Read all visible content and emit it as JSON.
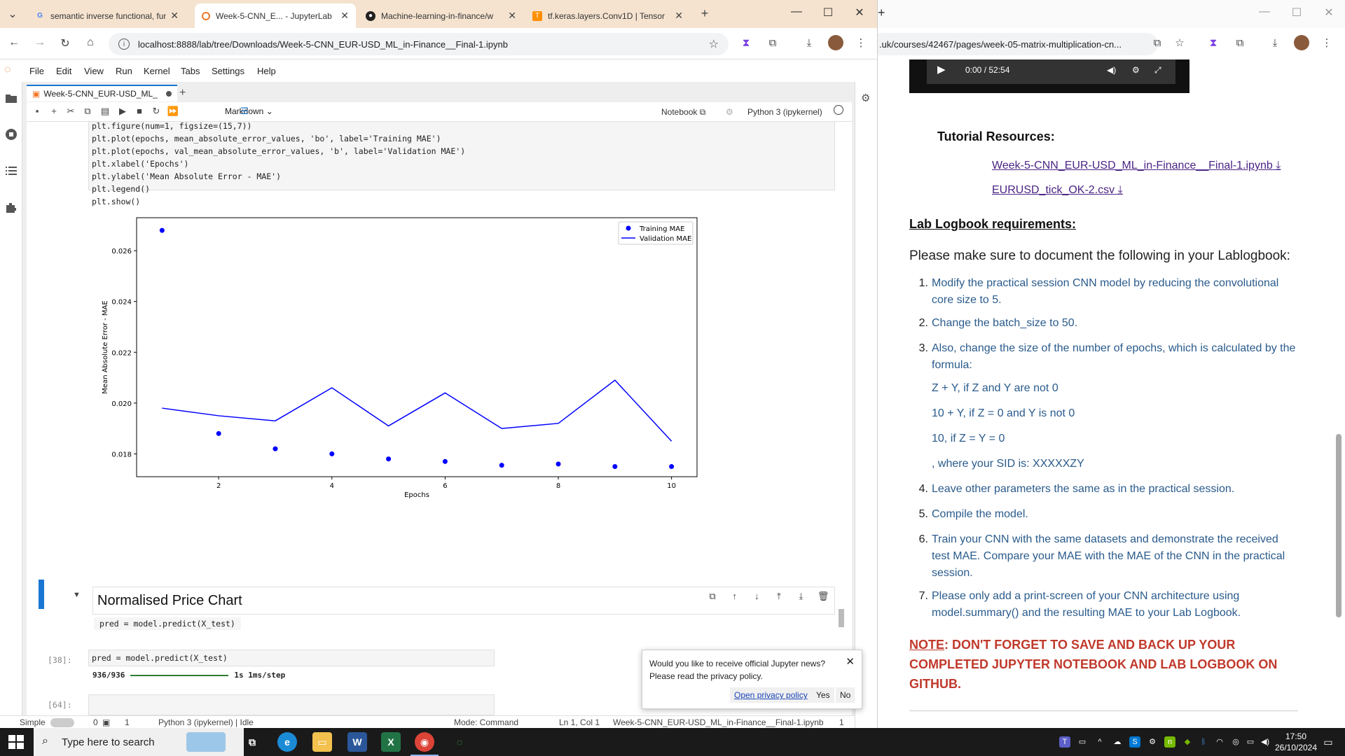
{
  "left_browser": {
    "tabs": [
      {
        "title": "semantic inverse functional, fun",
        "icon": "google-icon"
      },
      {
        "title": "Week-5-CNN_E... - JupyterLab",
        "icon": "jupyter-icon"
      },
      {
        "title": "Machine-learning-in-finance/w",
        "icon": "github-icon"
      },
      {
        "title": "tf.keras.layers.Conv1D | Tensor",
        "icon": "tensorflow-icon"
      }
    ],
    "new_tab": "+",
    "url": "localhost:8888/lab/tree/Downloads/Week-5-CNN_EUR-USD_ML_in-Finance__Final-1.ipynb"
  },
  "jupyter": {
    "menu": [
      "File",
      "Edit",
      "View",
      "Run",
      "Kernel",
      "Tabs",
      "Settings",
      "Help"
    ],
    "notebook_tab": "Week-5-CNN_EUR-USD_ML_",
    "cell_type": "Markdown",
    "notebook_label": "Notebook",
    "kernel_label": "Python 3 (ipykernel)",
    "code_top": [
      "plt.figure(num=1, figsize=(15,7))",
      "plt.plot(epochs, mean_absolute_error_values, 'bo', label='Training MAE')",
      "plt.plot(epochs, val_mean_absolute_error_values, 'b', label='Validation MAE')",
      "plt.xlabel('Epochs')",
      "plt.ylabel('Mean Absolute Error - MAE')",
      "plt.legend()",
      "plt.show()"
    ],
    "heading": "Normalised Price Chart",
    "md_code": "pred = model.predict(X_test)",
    "cell38_prompt": "[38]:",
    "cell38_code": "pred = model.predict(X_test)",
    "cell38_output_steps": "936/936",
    "cell38_output_time": "1s 1ms/step",
    "cell64_prompt": "[64]:",
    "status": {
      "simple": "Simple",
      "zero": "0",
      "one": "1",
      "kernel": "Python 3 (ipykernel) | Idle",
      "mode": "Mode: Command",
      "pos": "Ln 1, Col 1",
      "file": "Week-5-CNN_EUR-USD_ML_in-Finance__Final-1.ipynb",
      "count": "1"
    },
    "toast": {
      "message": "Would you like to receive official Jupyter news? Please read the privacy policy.",
      "link": "Open privacy policy",
      "yes": "Yes",
      "no": "No"
    }
  },
  "chart_data": {
    "type": "line",
    "xlabel": "Epochs",
    "ylabel": "Mean Absolute Error - MAE",
    "x": [
      1,
      2,
      3,
      4,
      5,
      6,
      7,
      8,
      9,
      10
    ],
    "xticks": [
      2,
      4,
      6,
      8,
      10
    ],
    "yticks": [
      0.018,
      0.02,
      0.022,
      0.024,
      0.026
    ],
    "xlim": [
      0.55,
      10.45
    ],
    "ylim": [
      0.0171,
      0.0273
    ],
    "series": [
      {
        "name": "Training MAE",
        "style": "points",
        "color": "#0000ff",
        "values": [
          0.0268,
          0.0188,
          0.0182,
          0.018,
          0.0178,
          0.0177,
          0.01755,
          0.0176,
          0.0175,
          0.0175
        ]
      },
      {
        "name": "Validation MAE",
        "style": "line",
        "color": "#0000ff",
        "values": [
          0.0198,
          0.0195,
          0.0193,
          0.0206,
          0.0191,
          0.0204,
          0.019,
          0.0192,
          0.0209,
          0.0185
        ]
      }
    ],
    "legend": "top-right"
  },
  "right_browser": {
    "url": ".uk/courses/42467/pages/week-05-matrix-multiplication-cn...",
    "video_time": "0:00 / 52:54",
    "resources_title": "Tutorial Resources:",
    "resources": [
      "Week-5-CNN_EUR-USD_ML_in-Finance__Final-1.ipynb",
      "EURUSD_tick_OK-2.csv"
    ],
    "logbook_title": "Lab Logbook requirements:",
    "intro": "Please make sure to document the following in your Lablogbook:",
    "items": [
      {
        "n": "1.",
        "text": "Modify the practical session CNN model by reducing the convolutional core size to 5."
      },
      {
        "n": "2.",
        "text": "Change the batch_size to 50."
      },
      {
        "n": "3.",
        "text": "Also, change the size of the number of epochs, which is calculated by the formula:"
      },
      {
        "n": "",
        "text": "Z + Y, if Z and Y are not 0"
      },
      {
        "n": "",
        "text": "10 + Y, if Z = 0 and Y is not 0"
      },
      {
        "n": "",
        "text": "10, if Z = Y = 0"
      },
      {
        "n": "",
        "text": ", where your SID is: XXXXXZY"
      },
      {
        "n": "4.",
        "text": "Leave other parameters the same as in the practical session."
      },
      {
        "n": "5.",
        "text": "Compile the model."
      },
      {
        "n": "6.",
        "text": "Train your CNN with the same datasets and demonstrate the received test MAE. Compare your MAE with the MAE of the CNN in the practical session."
      },
      {
        "n": "7.",
        "text": "Please only add a print-screen of your CNN architecture using model.summary() and the resulting MAE to your Lab Logbook."
      }
    ],
    "note_label": "NOTE",
    "note_text": ": DON'T FORGET TO SAVE AND BACK UP YOUR COMPLETED JUPYTER NOTEBOOK AND LAB LOGBOOK ON GITHUB."
  },
  "taskbar": {
    "search_placeholder": "Type here to search",
    "time": "17:50",
    "date": "26/10/2024"
  }
}
